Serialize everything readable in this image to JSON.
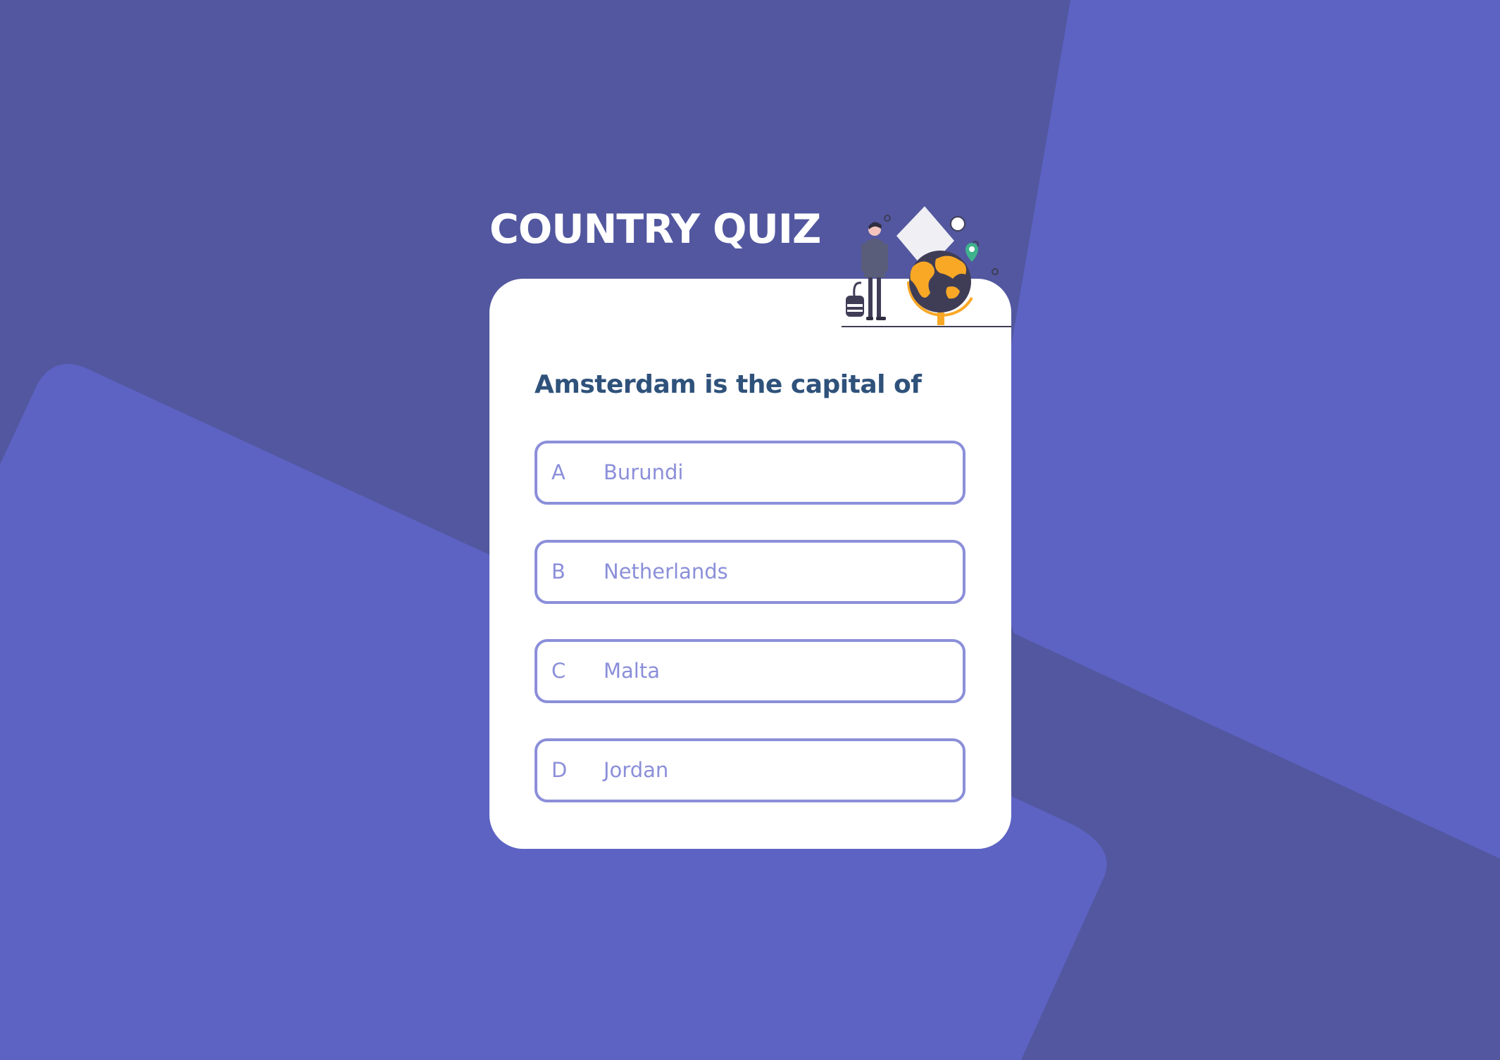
{
  "app": {
    "title": "COUNTRY QUIZ"
  },
  "quiz": {
    "question": "Amsterdam is the capital of",
    "options": [
      {
        "letter": "A",
        "text": "Burundi"
      },
      {
        "letter": "B",
        "text": "Netherlands"
      },
      {
        "letter": "C",
        "text": "Malta"
      },
      {
        "letter": "D",
        "text": "Jordan"
      }
    ]
  },
  "colors": {
    "background_dark": "#52579f",
    "background_light": "#5c63c3",
    "card": "#ffffff",
    "title": "#ffffff",
    "question": "#2f527b",
    "option_accent": "#8b8fd9",
    "illustration_globe": "#f9a826",
    "illustration_dark": "#3f3d56",
    "illustration_pin": "#3fb28c"
  },
  "icons": {
    "illustration": "traveler-with-globe-illustration"
  }
}
